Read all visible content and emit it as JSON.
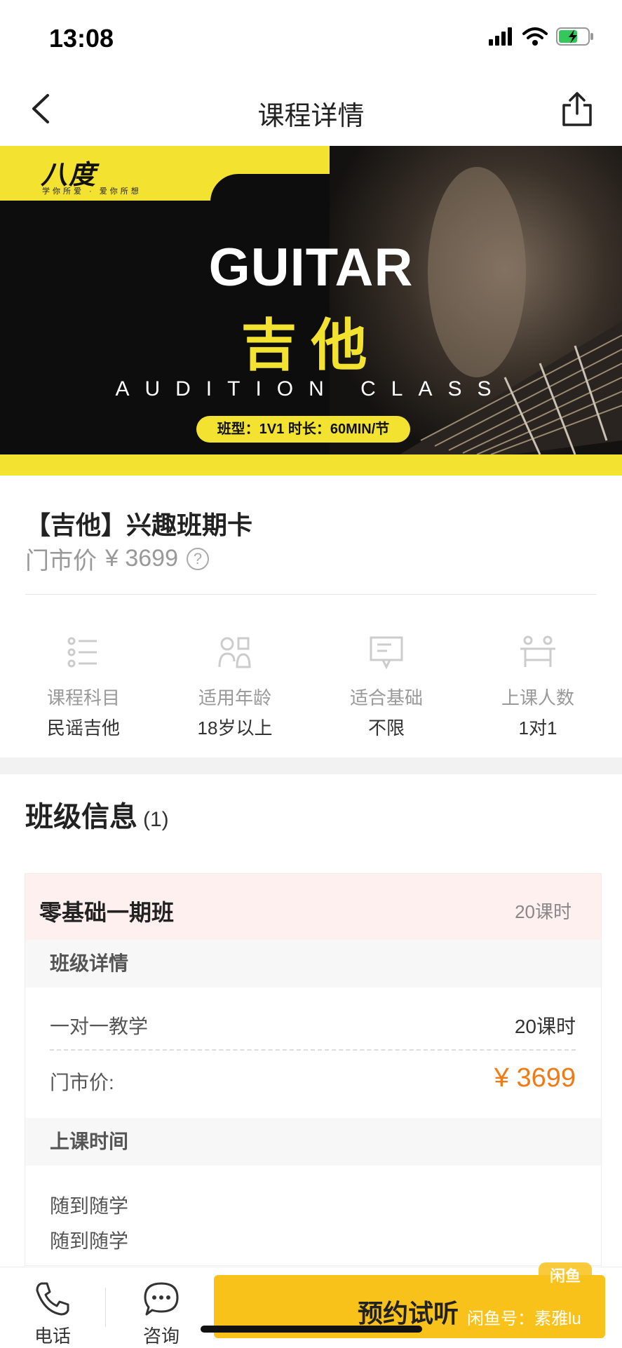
{
  "status_bar": {
    "time": "13:08"
  },
  "nav": {
    "title": "课程详情"
  },
  "banner": {
    "logo_text": "八度",
    "logo_sub": "学你所爱 · 爱你所想",
    "title_en": "GUITAR",
    "title_cn": "吉他",
    "subtitle": "AUDITION CLASS",
    "pill": "班型：1V1 时长：60MIN/节"
  },
  "course": {
    "title": "【吉他】兴趣班期卡",
    "price_label": "门市价",
    "price": "¥ 3699",
    "help_glyph": "?"
  },
  "features": [
    {
      "label": "课程科目",
      "value": "民谣吉他",
      "icon": "list-icon"
    },
    {
      "label": "适用年龄",
      "value": "18岁以上",
      "icon": "age-icon"
    },
    {
      "label": "适合基础",
      "value": "不限",
      "icon": "board-icon"
    },
    {
      "label": "上课人数",
      "value": "1对1",
      "icon": "people-icon"
    }
  ],
  "class_section": {
    "title": "班级信息",
    "count": "(1)"
  },
  "class_card": {
    "name": "零基础一期班",
    "hours": "20课时",
    "detail_header": "班级详情",
    "teach_label": "一对一教学",
    "teach_hours": "20课时",
    "price_label": "门市价:",
    "price": "¥ 3699",
    "time_header": "上课时间",
    "time_lines": [
      "随到随学",
      "随到随学"
    ]
  },
  "bottom_bar": {
    "phone_label": "电话",
    "consult_label": "咨询",
    "cta_label": "预约试听",
    "watermark": "闲鱼号：素雅lu",
    "badge": "闲鱼"
  },
  "colors": {
    "accent": "#f8c21a",
    "price": "#f07a14",
    "banner_yellow": "#f3e230"
  }
}
